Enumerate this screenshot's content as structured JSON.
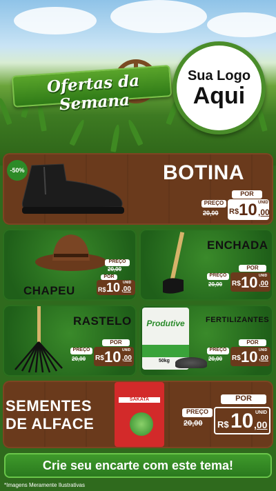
{
  "header": {
    "banner_title": "Ofertas da Semana",
    "logo_line1": "Sua Logo",
    "logo_line2": "Aqui"
  },
  "products": [
    {
      "name": "BOTINA",
      "discount": "-50%",
      "por_label": "POR",
      "preco_label": "PREÇO",
      "old_price": "20,00",
      "currency": "R$",
      "price_int": "10",
      "price_cents": ",00",
      "unit": "UNID"
    },
    {
      "name": "CHAPEU",
      "por_label": "POR",
      "preco_label": "PREÇO",
      "old_price": "20,00",
      "currency": "R$",
      "price_int": "10",
      "price_cents": ",00",
      "unit": "UNID"
    },
    {
      "name": "ENCHADA",
      "por_label": "POR",
      "preco_label": "PREÇO",
      "old_price": "20,00",
      "currency": "R$",
      "price_int": "10",
      "price_cents": ",00",
      "unit": "UNID"
    },
    {
      "name": "RASTELO",
      "por_label": "POR",
      "preco_label": "PREÇO",
      "old_price": "20,00",
      "currency": "R$",
      "price_int": "10",
      "price_cents": ",00",
      "unit": "UNID"
    },
    {
      "name": "FERTILIZANTES",
      "package_label": "Produtive",
      "package_weight": "50kg",
      "por_label": "POR",
      "preco_label": "PREÇO",
      "old_price": "20,00",
      "currency": "R$",
      "price_int": "10",
      "price_cents": ",00",
      "unit": "UNID"
    },
    {
      "name_line1": "SEMENTES",
      "name_line2": "DE ALFACE",
      "package_brand": "SAKATA",
      "por_label": "POR",
      "preco_label": "PREÇO",
      "old_price": "20,00",
      "currency": "R$",
      "price_int": "10",
      "price_cents": ",00",
      "unit": "UNID"
    }
  ],
  "footer": {
    "cta": "Crie seu encarte com este tema!",
    "note": "*Imagens Meramente Ilustrativas"
  },
  "colors": {
    "wood": "#6a3a1c",
    "green": "#2f6a1d",
    "tag_brown": "#5a2a12"
  }
}
